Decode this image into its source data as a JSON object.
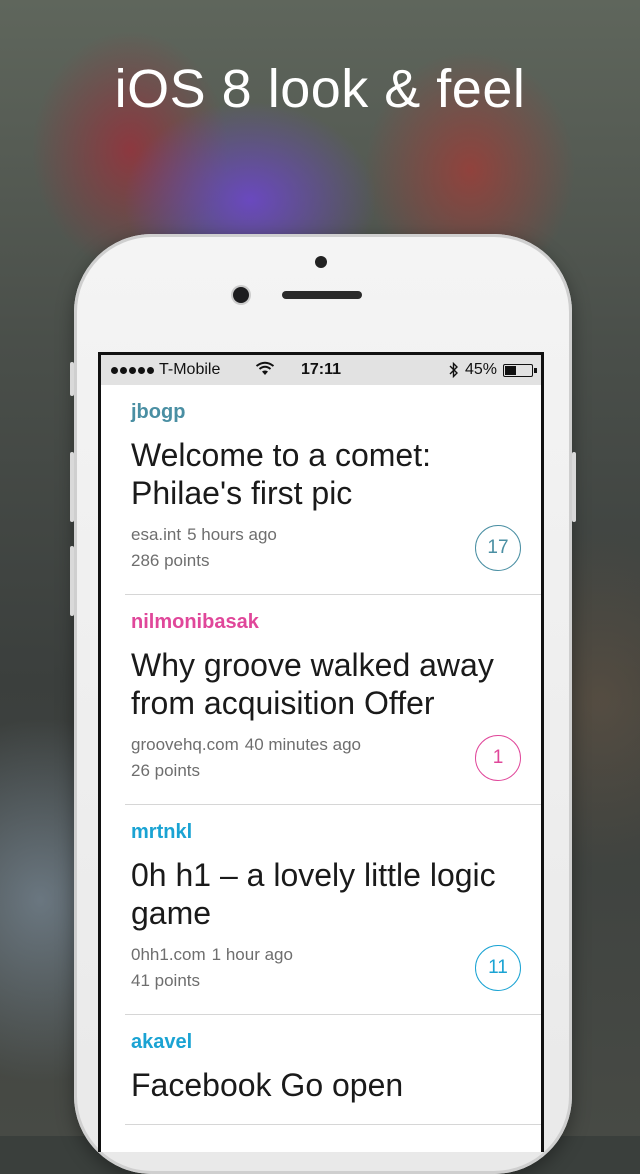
{
  "headline": "iOS 8 look & feel",
  "status_bar": {
    "carrier": "T-Mobile",
    "time": "17:11",
    "battery": "45%",
    "battery_level": 0.45
  },
  "colors": {
    "teal": "#4a8fa3",
    "pink": "#e0479a",
    "cyan": "#1aa3d3"
  },
  "stories": [
    {
      "user": "jbogp",
      "user_color": "#4a8fa3",
      "title": "Welcome to a comet: Philae's first pic",
      "domain": "esa.int",
      "time": "5 hours ago",
      "points": "286 points",
      "comments": "17"
    },
    {
      "user": "nilmonibasak",
      "user_color": "#e0479a",
      "title": "Why groove walked away from acquisition Offer",
      "domain": "groovehq.com",
      "time": "40 minutes ago",
      "points": "26 points",
      "comments": "1"
    },
    {
      "user": "mrtnkl",
      "user_color": "#1aa3d3",
      "title": "0h h1 – a lovely little logic game",
      "domain": "0hh1.com",
      "time": "1 hour ago",
      "points": "41 points",
      "comments": "11"
    },
    {
      "user": "akavel",
      "user_color": "#1aa3d3",
      "title": "Facebook Go open",
      "domain": "",
      "time": "",
      "points": "",
      "comments": ""
    }
  ]
}
